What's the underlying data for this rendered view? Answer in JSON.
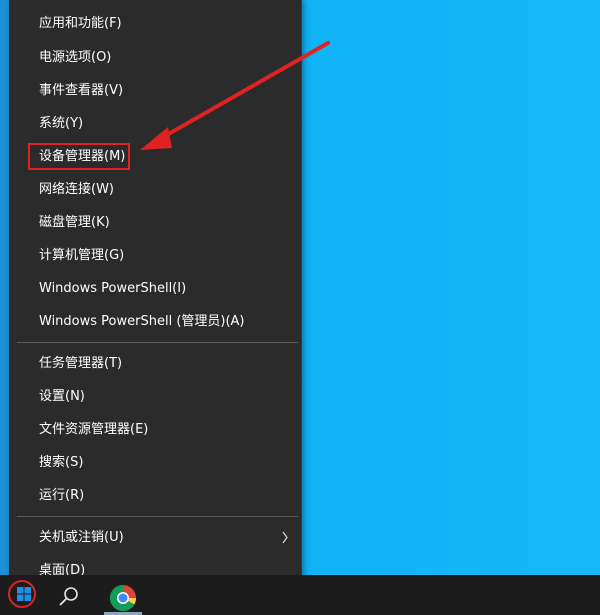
{
  "desktop": {
    "background_color": "#0fb2f6"
  },
  "menu": {
    "items_group1": [
      {
        "label": "应用和功能(F)"
      },
      {
        "label": "电源选项(O)"
      },
      {
        "label": "事件查看器(V)"
      },
      {
        "label": "系统(Y)"
      },
      {
        "label": "设备管理器(M)"
      },
      {
        "label": "网络连接(W)"
      },
      {
        "label": "磁盘管理(K)"
      },
      {
        "label": "计算机管理(G)"
      },
      {
        "label": "Windows PowerShell(I)"
      },
      {
        "label": "Windows PowerShell (管理员)(A)"
      }
    ],
    "items_group2": [
      {
        "label": "任务管理器(T)"
      },
      {
        "label": "设置(N)"
      },
      {
        "label": "文件资源管理器(E)"
      },
      {
        "label": "搜索(S)"
      },
      {
        "label": "运行(R)"
      }
    ],
    "items_group3": [
      {
        "label": "关机或注销(U)"
      },
      {
        "label": "桌面(D)"
      }
    ],
    "highlighted_item": "设备管理器(M)"
  },
  "taskbar": {
    "icons": [
      "windows-start-icon",
      "search-icon",
      "chrome-icon"
    ]
  },
  "annotation_colors": {
    "highlight": "#e02222"
  }
}
